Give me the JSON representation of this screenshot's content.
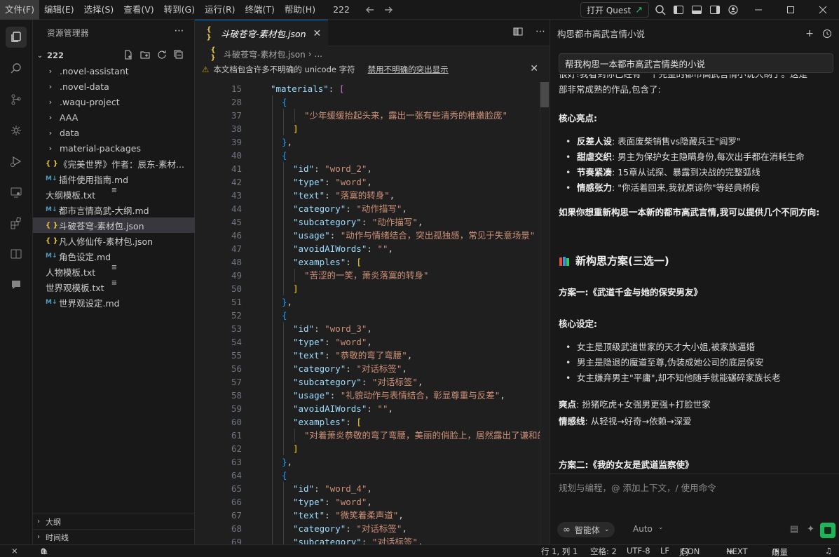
{
  "menu": [
    "文件(F)",
    "编辑(E)",
    "选择(S)",
    "查看(V)",
    "转到(G)",
    "运行(R)",
    "终端(T)",
    "帮助(H)"
  ],
  "window_title": "222",
  "quest_button": "打开 Quest",
  "sidebar": {
    "title": "资源管理器",
    "workspace": "222",
    "items": [
      {
        "type": "folder",
        "label": ".novel-assistant"
      },
      {
        "type": "folder",
        "label": ".novel-data"
      },
      {
        "type": "folder",
        "label": ".waqu-project"
      },
      {
        "type": "folder",
        "label": "AAA"
      },
      {
        "type": "folder",
        "label": "data"
      },
      {
        "type": "folder",
        "label": "material-packages"
      },
      {
        "type": "json",
        "label": "《完美世界》作者：辰东-素材..."
      },
      {
        "type": "md",
        "label": "插件使用指南.md"
      },
      {
        "type": "txt",
        "label": "大纲模板.txt"
      },
      {
        "type": "md",
        "label": "都市言情高武-大纲.md"
      },
      {
        "type": "json",
        "label": "斗破苍穹-素材包.json",
        "selected": true
      },
      {
        "type": "json",
        "label": "凡人修仙传-素材包.json"
      },
      {
        "type": "md",
        "label": "角色设定.md"
      },
      {
        "type": "txt",
        "label": "人物模板.txt"
      },
      {
        "type": "txt",
        "label": "世界观模板.txt"
      },
      {
        "type": "md",
        "label": "世界观设定.md"
      }
    ],
    "outline_section": "大纲",
    "timeline_section": "时间线"
  },
  "editor": {
    "tab_label": "斗破苍穹-素材包.json",
    "breadcrumb_file": "斗破苍穹-素材包.json",
    "breadcrumb_more": "...",
    "warning_text": "本文档包含许多不明确的 unicode 字符",
    "warning_link": "禁用不明确的突出显示",
    "lines": [
      {
        "n": "15",
        "t": [
          [
            "k",
            "\"materials\""
          ],
          [
            "p",
            ": "
          ],
          [
            "b1",
            "["
          ]
        ],
        "i": 1
      },
      {
        "n": "28",
        "t": [
          [
            "b2",
            "{"
          ]
        ],
        "i": 2
      },
      {
        "n": "37",
        "t": [
          [
            "s",
            "\"少年缓缓抬起头来，露出一张有些清秀的稚嫩脸庞\""
          ]
        ],
        "i": 4
      },
      {
        "n": "38",
        "t": [
          [
            "b3",
            "]"
          ]
        ],
        "i": 3
      },
      {
        "n": "39",
        "t": [
          [
            "b2",
            "}"
          ],
          [
            "p",
            ","
          ]
        ],
        "i": 2
      },
      {
        "n": "40",
        "t": [
          [
            "b2",
            "{"
          ]
        ],
        "i": 2
      },
      {
        "n": "41",
        "t": [
          [
            "k",
            "\"id\""
          ],
          [
            "p",
            ": "
          ],
          [
            "s",
            "\"word_2\""
          ],
          [
            "p",
            ","
          ]
        ],
        "i": 3
      },
      {
        "n": "42",
        "t": [
          [
            "k",
            "\"type\""
          ],
          [
            "p",
            ": "
          ],
          [
            "s",
            "\"word\""
          ],
          [
            "p",
            ","
          ]
        ],
        "i": 3
      },
      {
        "n": "43",
        "t": [
          [
            "k",
            "\"text\""
          ],
          [
            "p",
            ": "
          ],
          [
            "s",
            "\"落寞的转身\""
          ],
          [
            "p",
            ","
          ]
        ],
        "i": 3
      },
      {
        "n": "44",
        "t": [
          [
            "k",
            "\"category\""
          ],
          [
            "p",
            ": "
          ],
          [
            "s",
            "\"动作描写\""
          ],
          [
            "p",
            ","
          ]
        ],
        "i": 3
      },
      {
        "n": "45",
        "t": [
          [
            "k",
            "\"subcategory\""
          ],
          [
            "p",
            ": "
          ],
          [
            "s",
            "\"动作描写\""
          ],
          [
            "p",
            ","
          ]
        ],
        "i": 3
      },
      {
        "n": "46",
        "t": [
          [
            "k",
            "\"usage\""
          ],
          [
            "p",
            ": "
          ],
          [
            "s",
            "\"动作与情绪结合，突出孤独感，常见于失意场景\""
          ]
        ],
        "i": 3
      },
      {
        "n": "47",
        "t": [
          [
            "k",
            "\"avoidAIWords\""
          ],
          [
            "p",
            ": "
          ],
          [
            "s",
            "\"\""
          ],
          [
            "p",
            ","
          ]
        ],
        "i": 3
      },
      {
        "n": "48",
        "t": [
          [
            "k",
            "\"examples\""
          ],
          [
            "p",
            ": "
          ],
          [
            "b3",
            "["
          ]
        ],
        "i": 3
      },
      {
        "n": "49",
        "t": [
          [
            "s",
            "\"苦涩的一笑，萧炎落寞的转身\""
          ]
        ],
        "i": 4
      },
      {
        "n": "50",
        "t": [
          [
            "b3",
            "]"
          ]
        ],
        "i": 3
      },
      {
        "n": "51",
        "t": [
          [
            "b2",
            "}"
          ],
          [
            "p",
            ","
          ]
        ],
        "i": 2
      },
      {
        "n": "52",
        "t": [
          [
            "b2",
            "{"
          ]
        ],
        "i": 2
      },
      {
        "n": "53",
        "t": [
          [
            "k",
            "\"id\""
          ],
          [
            "p",
            ": "
          ],
          [
            "s",
            "\"word_3\""
          ],
          [
            "p",
            ","
          ]
        ],
        "i": 3
      },
      {
        "n": "54",
        "t": [
          [
            "k",
            "\"type\""
          ],
          [
            "p",
            ": "
          ],
          [
            "s",
            "\"word\""
          ],
          [
            "p",
            ","
          ]
        ],
        "i": 3
      },
      {
        "n": "55",
        "t": [
          [
            "k",
            "\"text\""
          ],
          [
            "p",
            ": "
          ],
          [
            "s",
            "\"恭敬的弯了弯腰\""
          ],
          [
            "p",
            ","
          ]
        ],
        "i": 3
      },
      {
        "n": "56",
        "t": [
          [
            "k",
            "\"category\""
          ],
          [
            "p",
            ": "
          ],
          [
            "s",
            "\"对话标签\""
          ],
          [
            "p",
            ","
          ]
        ],
        "i": 3
      },
      {
        "n": "57",
        "t": [
          [
            "k",
            "\"subcategory\""
          ],
          [
            "p",
            ": "
          ],
          [
            "s",
            "\"对话标签\""
          ],
          [
            "p",
            ","
          ]
        ],
        "i": 3
      },
      {
        "n": "58",
        "t": [
          [
            "k",
            "\"usage\""
          ],
          [
            "p",
            ": "
          ],
          [
            "s",
            "\"礼貌动作与表情结合，彰显尊重与反差\""
          ],
          [
            "p",
            ","
          ]
        ],
        "i": 3
      },
      {
        "n": "59",
        "t": [
          [
            "k",
            "\"avoidAIWords\""
          ],
          [
            "p",
            ": "
          ],
          [
            "s",
            "\"\""
          ],
          [
            "p",
            ","
          ]
        ],
        "i": 3
      },
      {
        "n": "60",
        "t": [
          [
            "k",
            "\"examples\""
          ],
          [
            "p",
            ": "
          ],
          [
            "b3",
            "["
          ]
        ],
        "i": 3
      },
      {
        "n": "61",
        "t": [
          [
            "s",
            "\"对着萧炎恭敬的弯了弯腰，美丽的俏脸上，居然露出了谦和的笑容\""
          ]
        ],
        "i": 4
      },
      {
        "n": "62",
        "t": [
          [
            "b3",
            "]"
          ]
        ],
        "i": 3
      },
      {
        "n": "63",
        "t": [
          [
            "b2",
            "}"
          ],
          [
            "p",
            ","
          ]
        ],
        "i": 2
      },
      {
        "n": "64",
        "t": [
          [
            "b2",
            "{"
          ]
        ],
        "i": 2
      },
      {
        "n": "65",
        "t": [
          [
            "k",
            "\"id\""
          ],
          [
            "p",
            ": "
          ],
          [
            "s",
            "\"word_4\""
          ],
          [
            "p",
            ","
          ]
        ],
        "i": 3
      },
      {
        "n": "66",
        "t": [
          [
            "k",
            "\"type\""
          ],
          [
            "p",
            ": "
          ],
          [
            "s",
            "\"word\""
          ],
          [
            "p",
            ","
          ]
        ],
        "i": 3
      },
      {
        "n": "67",
        "t": [
          [
            "k",
            "\"text\""
          ],
          [
            "p",
            ": "
          ],
          [
            "s",
            "\"微笑着柔声道\""
          ],
          [
            "p",
            ","
          ]
        ],
        "i": 3
      },
      {
        "n": "68",
        "t": [
          [
            "k",
            "\"category\""
          ],
          [
            "p",
            ": "
          ],
          [
            "s",
            "\"对话标签\""
          ],
          [
            "p",
            ","
          ]
        ],
        "i": 3
      },
      {
        "n": "69",
        "t": [
          [
            "k",
            "\"subcategory\""
          ],
          [
            "p",
            ": "
          ],
          [
            "s",
            "\"对话标签\""
          ],
          [
            "p",
            ","
          ]
        ],
        "i": 3
      }
    ]
  },
  "chat": {
    "title": "构思都市高武言情小说",
    "user_message": "帮我构思一本都市高武言情类的小说",
    "reply_top": "很好!我看到你已经有一个完整的都市高武言情小说大纲了。这是一",
    "reply_line2": "部非常成熟的作品,包含了:",
    "highlights_heading": "核心亮点:",
    "highlights": [
      {
        "b": "反差人设",
        "t": ": 表面废柴销售vs隐藏兵王\"阎罗\""
      },
      {
        "b": "甜虐交织",
        "t": ": 男主为保护女主隐瞒身份,每次出手都在消耗生命"
      },
      {
        "b": "节奏紧凑",
        "t": ": 15章从试探、暴露到决战的完整弧线"
      },
      {
        "b": "情感张力",
        "t": ": \"你活着回来,我就原谅你\"等经典桥段"
      }
    ],
    "offer": "如果你想重新构思一本新的都市高武言情,我可以提供几个不同方向:",
    "plans_heading": "新构思方案(三选一)",
    "plan1_title": "方案一:《武道千金与她的保安男友》",
    "core_setting": "核心设定:",
    "plan1_points": [
      "女主是顶级武道世家的天才大小姐,被家族逼婚",
      "男主是隐退的魔道至尊,伪装成她公司的底层保安",
      "女主嫌弃男主\"平庸\",却不知他随手就能碾碎家族长老"
    ],
    "selling_label": "爽点",
    "selling_text": ": 扮猪吃虎+女强男更强+打脸世家",
    "emotion_label": "情感线",
    "emotion_text": ": 从轻视→好奇→依赖→深爱",
    "plan2_title": "方案二:《我的女友是武道监察使》",
    "input_placeholder": "规划与编程，@ 添加上下文，/ 使用命令",
    "agent_label": "智能体",
    "auto_label": "Auto"
  },
  "status": {
    "errors": "0",
    "warnings": "0",
    "position": "行 1, 列 1",
    "spaces": "空格: 2",
    "encoding": "UTF-8",
    "eol": "LF",
    "language": "JSON",
    "next": "NEXT",
    "usage": "用量"
  }
}
